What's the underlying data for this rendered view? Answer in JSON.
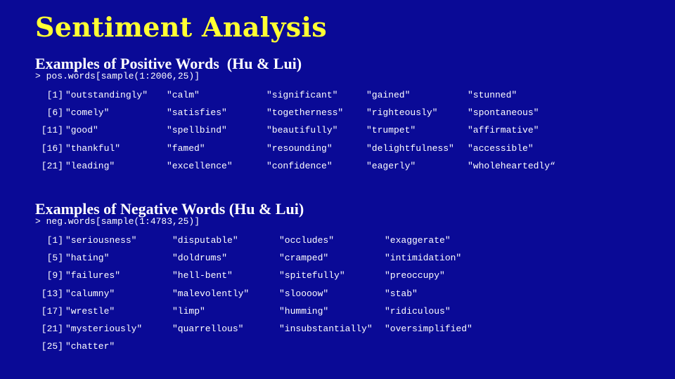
{
  "title": "Sentiment Analysis",
  "positive": {
    "heading": "Examples of Positive Words  (Hu & Lui)",
    "command": "> pos.words[sample(1:2006,25)]",
    "rows": [
      {
        "index": "[1]",
        "words": [
          "\"outstandingly\"",
          "\"calm\"",
          "\"significant\"",
          "\"gained\"",
          "\"stunned\""
        ]
      },
      {
        "index": "[6]",
        "words": [
          "\"comely\"",
          "\"satisfies\"",
          "\"togetherness\"",
          "\"righteously\"",
          "\"spontaneous\""
        ]
      },
      {
        "index": "[11]",
        "words": [
          "\"good\"",
          "\"spellbind\"",
          "\"beautifully\"",
          "\"trumpet\"",
          "\"affirmative\""
        ]
      },
      {
        "index": "[16]",
        "words": [
          "\"thankful\"",
          "\"famed\"",
          "\"resounding\"",
          "\"delightfulness\"",
          "\"accessible\""
        ]
      },
      {
        "index": "[21]",
        "words": [
          "\"leading\"",
          "\"excellence\"",
          "\"confidence\"",
          "\"eagerly\"",
          "\"wholeheartedly“"
        ]
      }
    ]
  },
  "negative": {
    "heading": "Examples of Negative Words (Hu & Lui)",
    "command": "> neg.words[sample(1:4783,25)]",
    "rows": [
      {
        "index": "[1]",
        "words": [
          "\"seriousness\"",
          "\"disputable\"",
          "\"occludes\"",
          "\"exaggerate\""
        ]
      },
      {
        "index": "[5]",
        "words": [
          "\"hating\"",
          "\"doldrums\"",
          "\"cramped\"",
          "\"intimidation\""
        ]
      },
      {
        "index": "[9]",
        "words": [
          "\"failures\"",
          "\"hell-bent\"",
          "\"spitefully\"",
          "\"preoccupy\""
        ]
      },
      {
        "index": "[13]",
        "words": [
          "\"calumny\"",
          "\"malevolently\"",
          "\"sloooow\"",
          "\"stab\""
        ]
      },
      {
        "index": "[17]",
        "words": [
          "\"wrestle\"",
          "\"limp\"",
          "\"humming\"",
          "\"ridiculous\""
        ]
      },
      {
        "index": "[21]",
        "words": [
          "\"mysteriously\"",
          "\"quarrellous\"",
          "\"insubstantially\"",
          "\"oversimplified\""
        ]
      },
      {
        "index": "[25]",
        "words": [
          "\"chatter\""
        ]
      }
    ]
  }
}
